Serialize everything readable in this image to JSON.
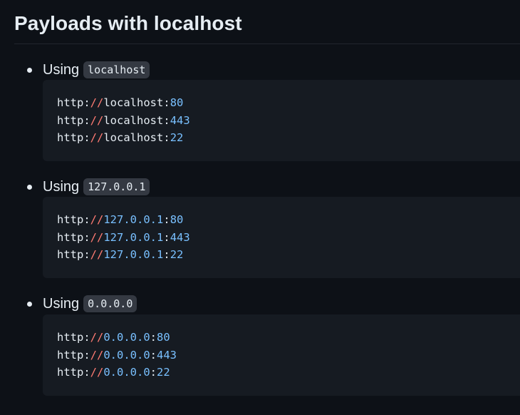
{
  "heading": "Payloads with localhost",
  "sections": [
    {
      "label": "Using",
      "code": "localhost",
      "host_style": "plain",
      "lines": [
        {
          "scheme": "http:",
          "slashes": "//",
          "host": "localhost",
          "colon": ":",
          "port": "80"
        },
        {
          "scheme": "http:",
          "slashes": "//",
          "host": "localhost",
          "colon": ":",
          "port": "443"
        },
        {
          "scheme": "http:",
          "slashes": "//",
          "host": "localhost",
          "colon": ":",
          "port": "22"
        }
      ]
    },
    {
      "label": "Using",
      "code": "127.0.0.1",
      "host_style": "num",
      "lines": [
        {
          "scheme": "http:",
          "slashes": "//",
          "host": "127.0.0.1",
          "colon": ":",
          "port": "80"
        },
        {
          "scheme": "http:",
          "slashes": "//",
          "host": "127.0.0.1",
          "colon": ":",
          "port": "443"
        },
        {
          "scheme": "http:",
          "slashes": "//",
          "host": "127.0.0.1",
          "colon": ":",
          "port": "22"
        }
      ]
    },
    {
      "label": "Using",
      "code": "0.0.0.0",
      "host_style": "num",
      "lines": [
        {
          "scheme": "http:",
          "slashes": "//",
          "host": "0.0.0.0",
          "colon": ":",
          "port": "80"
        },
        {
          "scheme": "http:",
          "slashes": "//",
          "host": "0.0.0.0",
          "colon": ":",
          "port": "443"
        },
        {
          "scheme": "http:",
          "slashes": "//",
          "host": "0.0.0.0",
          "colon": ":",
          "port": "22"
        }
      ]
    }
  ],
  "colors": {
    "background": "#0d1117",
    "code_background": "#161b22",
    "inline_code_background": "#343942",
    "text": "#e6edf3",
    "slash": "#ff7b72",
    "number": "#79c0ff"
  }
}
